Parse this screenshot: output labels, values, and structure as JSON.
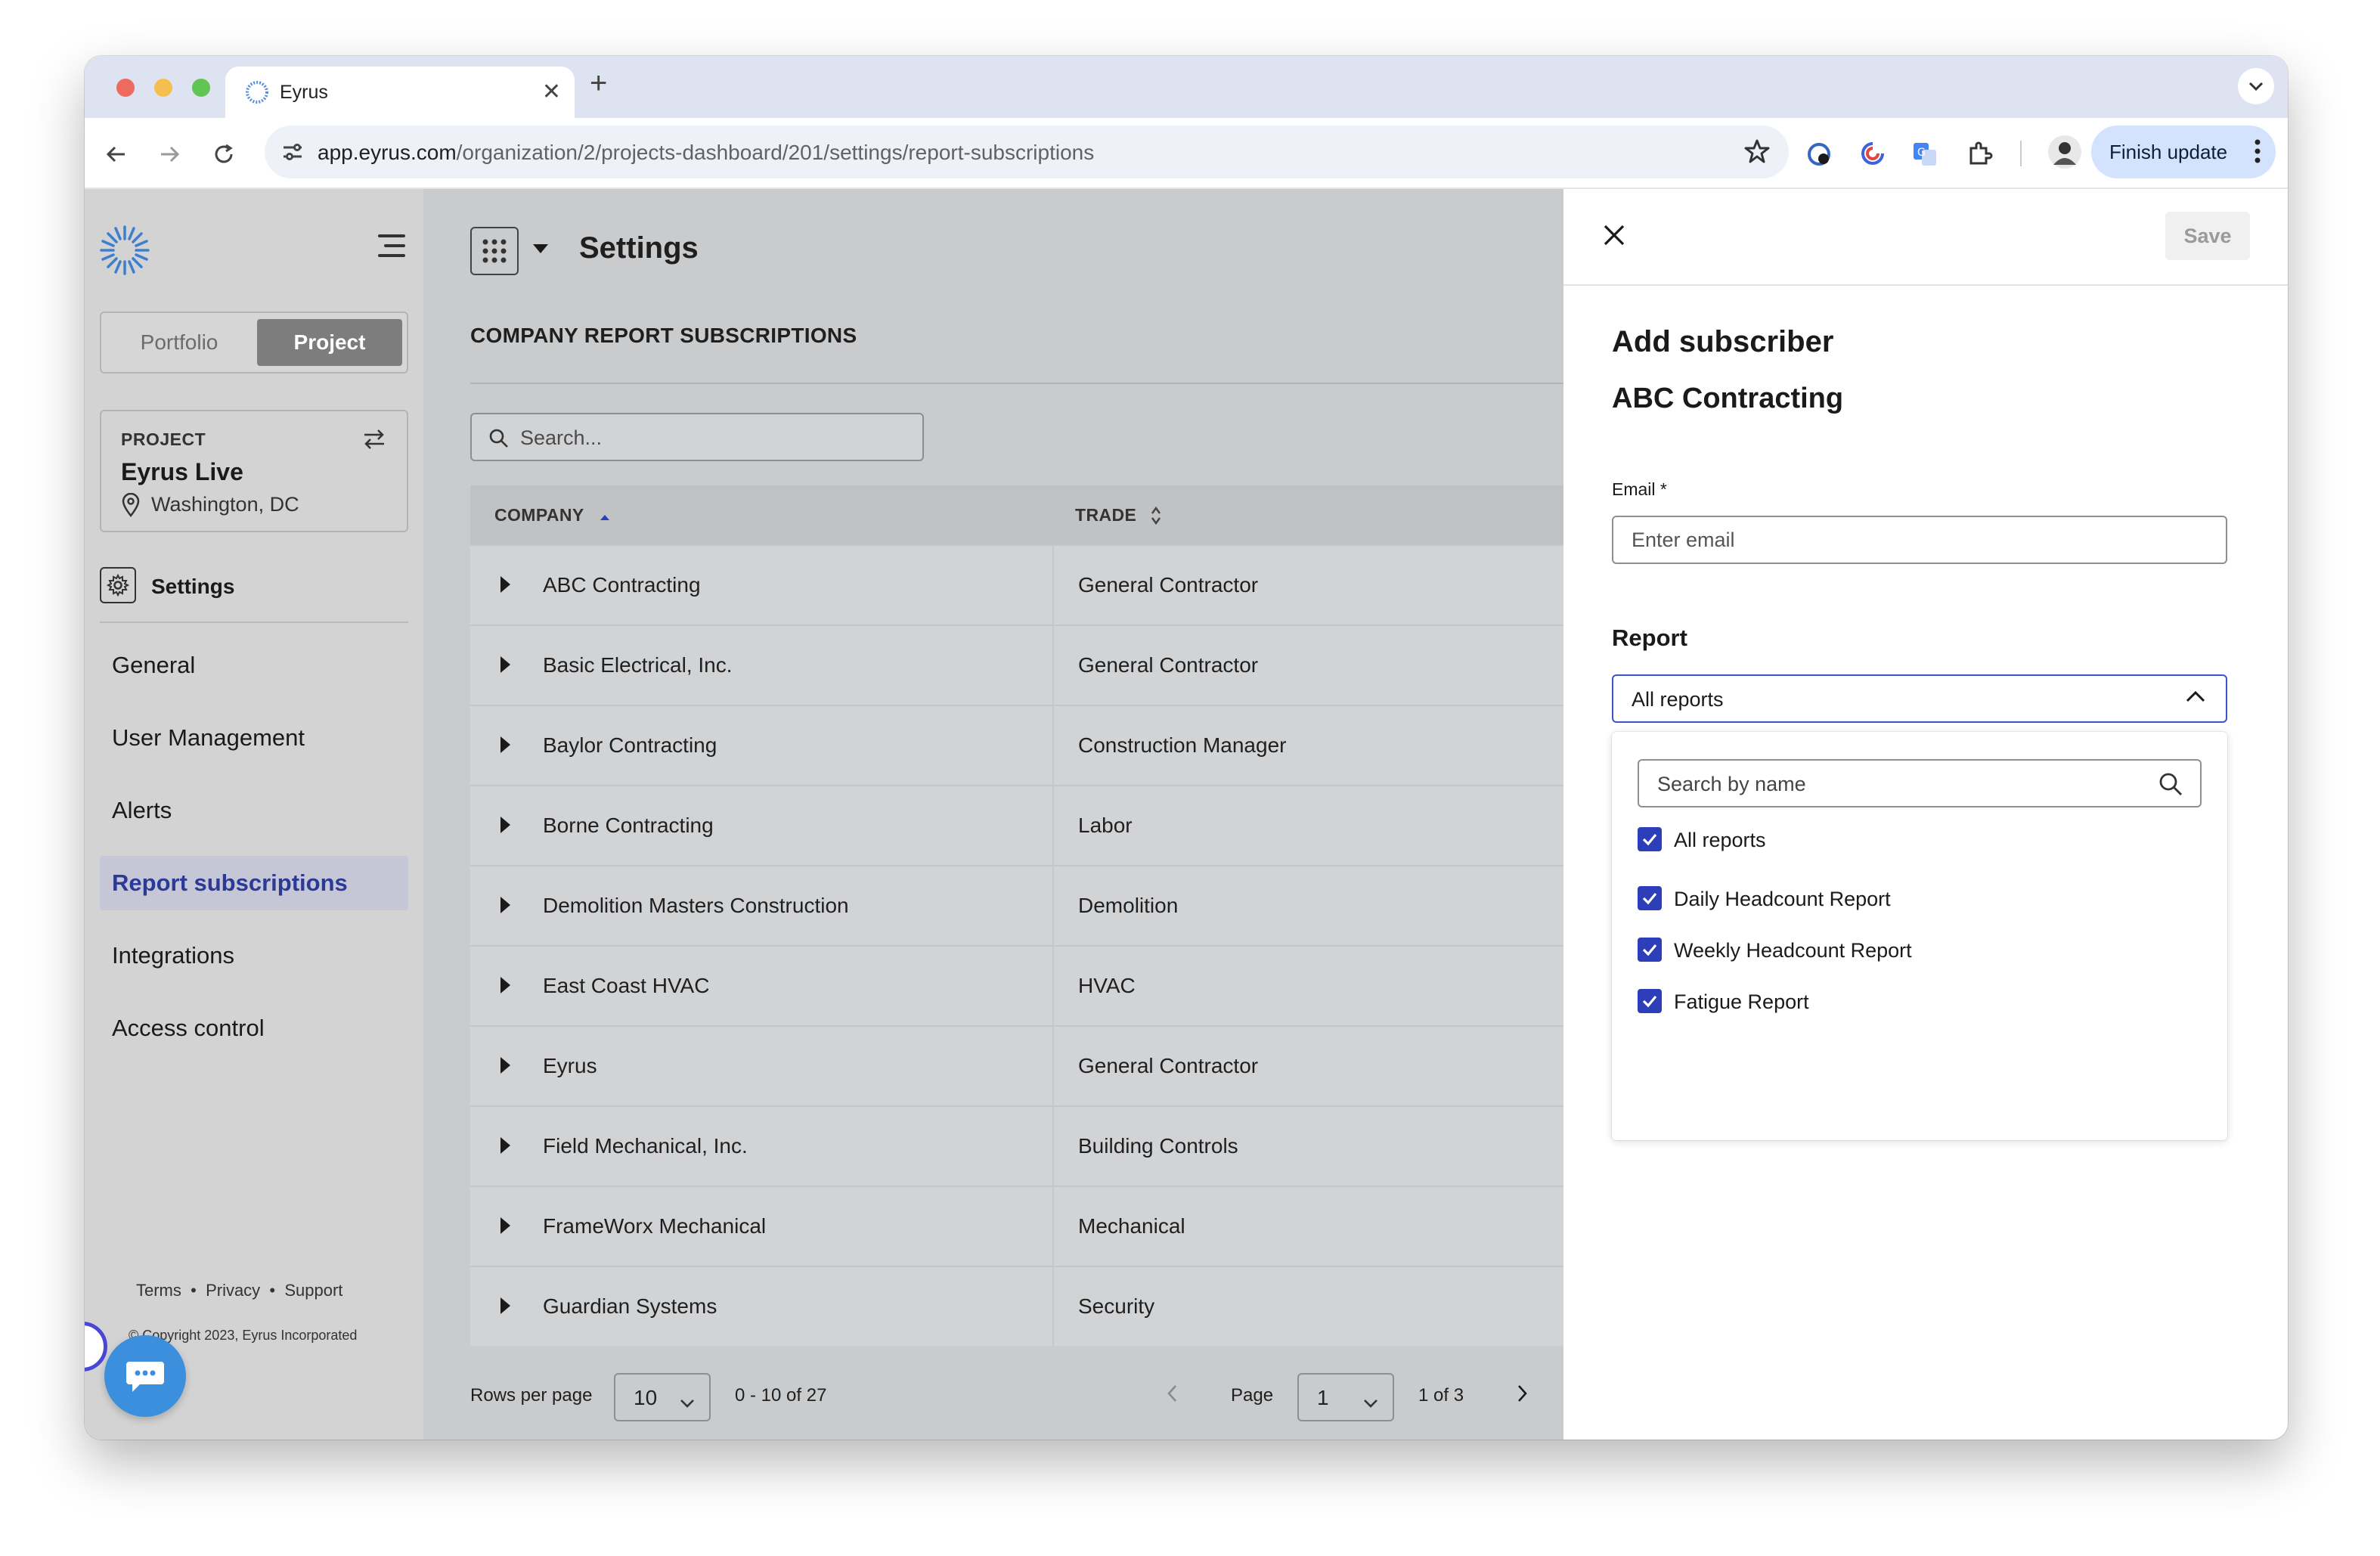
{
  "browser": {
    "tab_title": "Eyrus",
    "url_host": "app.eyrus.com",
    "url_path": "/organization/2/projects-dashboard/201/settings/report-subscriptions",
    "finish_update_label": "Finish update"
  },
  "sidebar": {
    "toggle": {
      "portfolio": "Portfolio",
      "project": "Project",
      "selected": "Project"
    },
    "project_card": {
      "label": "PROJECT",
      "name": "Eyrus Live",
      "location": "Washington, DC"
    },
    "settings_label": "Settings",
    "nav": [
      {
        "label": "General",
        "active": false
      },
      {
        "label": "User Management",
        "active": false
      },
      {
        "label": "Alerts",
        "active": false
      },
      {
        "label": "Report subscriptions",
        "active": true
      },
      {
        "label": "Integrations",
        "active": false
      },
      {
        "label": "Access control",
        "active": false
      }
    ],
    "footer": {
      "terms": "Terms",
      "privacy": "Privacy",
      "support": "Support",
      "separator": "•"
    },
    "copyright": "© Copyright 2023, Eyrus Incorporated"
  },
  "main": {
    "title": "Settings",
    "section_title": "COMPANY REPORT SUBSCRIPTIONS",
    "search_placeholder": "Search...",
    "columns": {
      "company": "COMPANY",
      "trade": "TRADE"
    },
    "rows": [
      {
        "company": "ABC Contracting",
        "trade": "General Contractor"
      },
      {
        "company": "Basic Electrical, Inc.",
        "trade": "General Contractor"
      },
      {
        "company": "Baylor Contracting",
        "trade": "Construction Manager"
      },
      {
        "company": "Borne Contracting",
        "trade": "Labor"
      },
      {
        "company": "Demolition Masters Construction",
        "trade": "Demolition"
      },
      {
        "company": "East Coast HVAC",
        "trade": "HVAC"
      },
      {
        "company": "Eyrus",
        "trade": "General Contractor"
      },
      {
        "company": "Field Mechanical, Inc.",
        "trade": "Building Controls"
      },
      {
        "company": "FrameWorx Mechanical",
        "trade": "Mechanical"
      },
      {
        "company": "Guardian Systems",
        "trade": "Security"
      }
    ],
    "pagination": {
      "rows_per_page_label": "Rows per page",
      "rows_per_page": "10",
      "range": "0 - 10 of 27",
      "page_label": "Page",
      "page": "1",
      "page_count": "1 of 3"
    }
  },
  "panel": {
    "save_label": "Save",
    "title": "Add subscriber",
    "company": "ABC Contracting",
    "email_label": "Email *",
    "email_placeholder": "Enter email",
    "email_value": "",
    "report_label": "Report",
    "report_selected": "All reports",
    "dropdown": {
      "search_placeholder": "Search by name",
      "options": [
        {
          "label": "All reports",
          "checked": true
        },
        {
          "label": "Daily Headcount Report",
          "checked": true
        },
        {
          "label": "Weekly Headcount Report",
          "checked": true
        },
        {
          "label": "Fatigue Report",
          "checked": true
        }
      ]
    }
  },
  "colors": {
    "accent": "#2c3fb8",
    "active_nav_text": "#2c3a96",
    "chat_button": "#3b8fdc",
    "overlay_main": "#cacbcd",
    "overlay_sidebar": "#d3d3d3"
  }
}
